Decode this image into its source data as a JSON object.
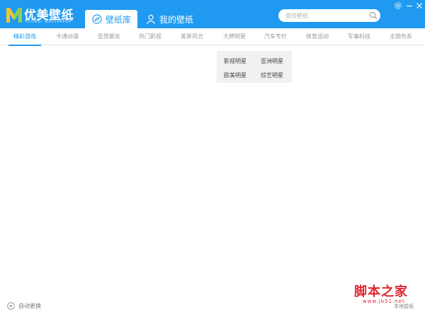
{
  "app": {
    "name": "优美壁纸",
    "subtitle": "YOUMEI WALLPAPER"
  },
  "tabs": [
    {
      "label": "壁纸库",
      "icon": "compass-icon",
      "active": true
    },
    {
      "label": "我的壁纸",
      "icon": "user-icon",
      "active": false
    }
  ],
  "search": {
    "placeholder": "查找壁纸",
    "icon": "search-icon"
  },
  "window_controls": [
    "settings-icon",
    "minimize-icon",
    "close-icon"
  ],
  "categories": [
    {
      "label": "精彩游戏",
      "active": true
    },
    {
      "label": "卡通动漫",
      "active": false
    },
    {
      "label": "型男靓女",
      "active": false
    },
    {
      "label": "热门影视",
      "active": false
    },
    {
      "label": "美景风光",
      "active": false
    },
    {
      "label": "大牌明星",
      "active": false
    },
    {
      "label": "汽车专栏",
      "active": false
    },
    {
      "label": "体育运动",
      "active": false
    },
    {
      "label": "军事科技",
      "active": false
    },
    {
      "label": "主题色系",
      "active": false
    }
  ],
  "dropdown": {
    "items": [
      "影视明星",
      "亚洲明星",
      "欧美明星",
      "综艺明星"
    ]
  },
  "footer": {
    "auto_change_label": "自动更换",
    "local_wallpaper_label": "本地壁纸"
  },
  "watermark": {
    "text": "脚本之家",
    "url": "www.jb51.net"
  },
  "colors": {
    "accent": "#1f9af0",
    "watermark": "#e0262c"
  }
}
